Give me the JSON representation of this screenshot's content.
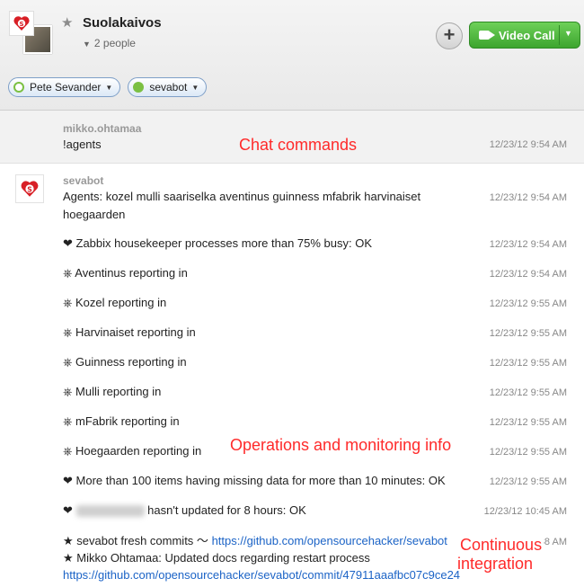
{
  "header": {
    "title": "Suolakaivos",
    "people_count": "2 people",
    "add_icon": "plus-icon",
    "video_call_label": "Video Call"
  },
  "participants": [
    {
      "name": "Pete Sevander"
    },
    {
      "name": "sevabot"
    }
  ],
  "messages": {
    "group1": {
      "sender": "mikko.ohtamaa",
      "text": "!agents",
      "time": "12/23/12 9:54 AM"
    },
    "group2": {
      "sender": "sevabot",
      "lines": [
        {
          "text1": "Agents: kozel mulli saariselka aventinus guinness mfabrik harvinaiset",
          "text2": "hoegaarden",
          "time": "12/23/12 9:54 AM"
        },
        {
          "text": "❤ Zabbix housekeeper processes more than 75% busy: OK",
          "time": "12/23/12 9:54 AM"
        },
        {
          "text": "⎈ Aventinus reporting in",
          "time": "12/23/12 9:54 AM"
        },
        {
          "text": "⎈ Kozel reporting in",
          "time": "12/23/12 9:55 AM"
        },
        {
          "text": "⎈ Harvinaiset reporting in",
          "time": "12/23/12 9:55 AM"
        },
        {
          "text": "⎈ Guinness reporting in",
          "time": "12/23/12 9:55 AM"
        },
        {
          "text": "⎈ Mulli reporting in",
          "time": "12/23/12 9:55 AM"
        },
        {
          "text": "⎈ mFabrik reporting in",
          "time": "12/23/12 9:55 AM"
        },
        {
          "text": "⎈ Hoegaarden reporting in",
          "time": "12/23/12 9:55 AM"
        },
        {
          "text": "❤ More than 100 items having missing data for more than 10 minutes: OK",
          "time": "12/23/12 9:55 AM"
        },
        {
          "prefix": "❤",
          "suffix": "hasn't updated for 8 hours: OK",
          "time": "12/23/12 10:45 AM"
        },
        {
          "text_a": "★ sevabot fresh commits 〜",
          "link_a": "https://github.com/opensourcehacker/sevabot",
          "text_b": "★ Mikko Ohtamaa: Updated docs regarding restart process",
          "link_b": "https://github.com/opensourcehacker/sevabot/commit/47911aaafbc07c9ce24",
          "time": "11:38 AM"
        }
      ]
    }
  },
  "annotations": {
    "chat_commands": "Chat commands",
    "operations": "Operations and monitoring info",
    "ci_line1": "Continuous",
    "ci_line2": "integration"
  },
  "colors": {
    "annotation": "#ff2a2a",
    "link": "#1b63c6",
    "video_button": "#3da52f"
  }
}
